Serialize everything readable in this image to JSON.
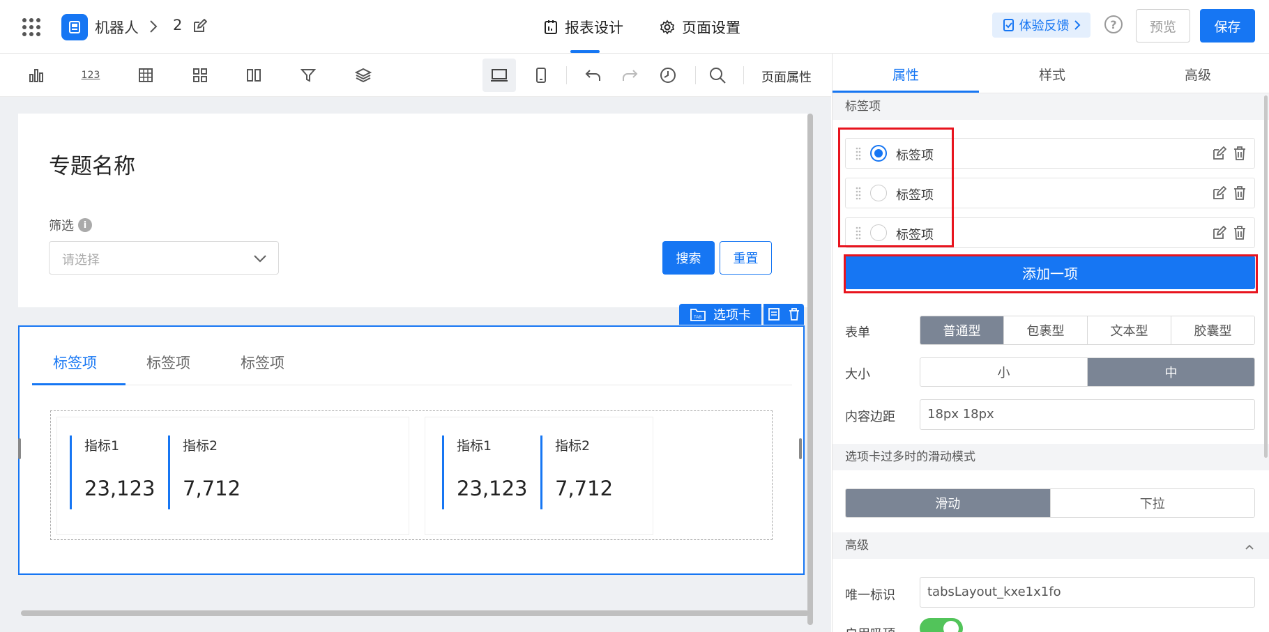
{
  "header": {
    "app_name": "机器人",
    "breadcrumb_num": "2",
    "tabs": [
      {
        "label": "报表设计",
        "active": true
      },
      {
        "label": "页面设置",
        "active": false
      }
    ],
    "feedback_label": "体验反馈",
    "help_label": "?",
    "preview_label": "预览",
    "save_label": "保存"
  },
  "toolbar": {
    "number_icon_text": "123",
    "page_props_label": "页面属性"
  },
  "canvas": {
    "page_title": "专题名称",
    "filter_label": "筛选",
    "filter_info": "i",
    "select_placeholder": "请选择",
    "search_label": "搜索",
    "reset_label": "重置",
    "component_badge": "选项卡",
    "component_badge_icon_text": "TAB",
    "tabs": [
      "标签项",
      "标签项",
      "标签项"
    ],
    "kpi_cards": [
      {
        "items": [
          {
            "label": "指标1",
            "value": "23,123"
          },
          {
            "label": "指标2",
            "value": "7,712"
          }
        ]
      },
      {
        "items": [
          {
            "label": "指标1",
            "value": "23,123"
          },
          {
            "label": "指标2",
            "value": "7,712"
          }
        ]
      }
    ]
  },
  "panel": {
    "tabs": [
      {
        "label": "属性",
        "active": true
      },
      {
        "label": "样式",
        "active": false
      },
      {
        "label": "高级",
        "active": false
      }
    ],
    "section_tab_items": "标签项",
    "tab_items": [
      {
        "label": "标签项",
        "selected": true
      },
      {
        "label": "标签项",
        "selected": false
      },
      {
        "label": "标签项",
        "selected": false
      }
    ],
    "add_item_label": "添加一项",
    "form_label": "表单",
    "form_options": [
      {
        "label": "普通型",
        "selected": true
      },
      {
        "label": "包裹型",
        "selected": false
      },
      {
        "label": "文本型",
        "selected": false
      },
      {
        "label": "胶囊型",
        "selected": false
      }
    ],
    "size_label": "大小",
    "size_options": [
      {
        "label": "小",
        "selected": false
      },
      {
        "label": "中",
        "selected": true
      }
    ],
    "padding_label": "内容边距",
    "padding_value": "18px 18px",
    "scroll_mode_label": "选项卡过多时的滑动模式",
    "scroll_options": [
      {
        "label": "滑动",
        "selected": true
      },
      {
        "label": "下拉",
        "selected": false
      }
    ],
    "advanced_section": "高级",
    "unique_id_label": "唯一标识",
    "unique_id_value": "tabsLayout_kxe1x1fo",
    "sticky_label": "启用吸顶",
    "sticky_enabled": true
  },
  "colors": {
    "primary": "#1676f3",
    "highlight_box": "#e8141e",
    "segment_selected": "#7b8595",
    "toggle_on": "#52c45a"
  }
}
